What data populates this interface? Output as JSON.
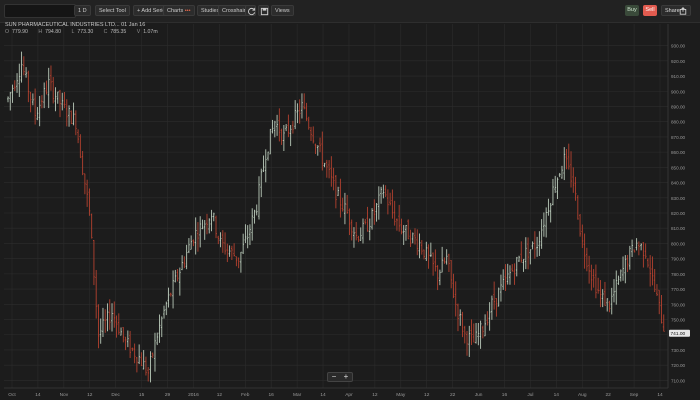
{
  "toolbar": {
    "symbol_value": "",
    "interval": "1 D",
    "select_tool": "Select Tool",
    "add_series": "+ Add Series",
    "charts_label": "Charts",
    "charts_accent": "•••",
    "studies": "Studies",
    "crosshair": "Crosshair",
    "views": "Views",
    "buy": "Buy",
    "sell": "Sell",
    "share": "Share"
  },
  "info": {
    "title": "SUN PHARMACEUTICAL INDUSTRIES LTD... 01 Jan 16",
    "ohlc": [
      {
        "k": "O",
        "v": "779.90"
      },
      {
        "k": "H",
        "v": "794.80"
      },
      {
        "k": "L",
        "v": "773.30"
      },
      {
        "k": "C",
        "v": "785.35"
      },
      {
        "k": "V",
        "v": "1.07m"
      }
    ]
  },
  "zoom": {
    "minus": "−",
    "plus": "+"
  },
  "colors": {
    "up": "#b9c9b9",
    "down": "#b3412f",
    "grid": "#2c2c2c",
    "background": "#1c1c1c",
    "last_price": "#e6e6e6"
  },
  "chart_data": {
    "type": "candlestick",
    "x_labels": [
      "Oct",
      "14",
      "Nov",
      "12",
      "Dec",
      "15",
      "29",
      "2016",
      "12",
      "Feb",
      "16",
      "Mar",
      "14",
      "Apr",
      "12",
      "May",
      "12",
      "22",
      "Jun",
      "16",
      "Jul",
      "14",
      "Aug",
      "22",
      "Sep",
      "14"
    ],
    "y_ticks": [
      "930.00",
      "920.00",
      "910.00",
      "900.00",
      "890.00",
      "880.00",
      "870.00",
      "860.00",
      "850.00",
      "840.00",
      "830.00",
      "820.00",
      "810.00",
      "800.00",
      "790.00",
      "780.00",
      "770.00",
      "760.00",
      "750.00",
      "740.00",
      "730.00",
      "720.00",
      "710.00"
    ],
    "last_price": "741.00",
    "ylim": [
      705,
      935
    ],
    "trend": [
      [
        0,
        895
      ],
      [
        6,
        918
      ],
      [
        12,
        885
      ],
      [
        18,
        905
      ],
      [
        24,
        890
      ],
      [
        30,
        880
      ],
      [
        36,
        820
      ],
      [
        40,
        740
      ],
      [
        46,
        755
      ],
      [
        52,
        735
      ],
      [
        58,
        725
      ],
      [
        62,
        715
      ],
      [
        66,
        740
      ],
      [
        70,
        760
      ],
      [
        74,
        775
      ],
      [
        78,
        790
      ],
      [
        82,
        805
      ],
      [
        86,
        812
      ],
      [
        90,
        820
      ],
      [
        94,
        800
      ],
      [
        98,
        795
      ],
      [
        102,
        790
      ],
      [
        106,
        805
      ],
      [
        110,
        825
      ],
      [
        114,
        860
      ],
      [
        118,
        880
      ],
      [
        122,
        870
      ],
      [
        126,
        880
      ],
      [
        130,
        890
      ],
      [
        134,
        875
      ],
      [
        138,
        860
      ],
      [
        142,
        845
      ],
      [
        146,
        830
      ],
      [
        150,
        820
      ],
      [
        154,
        805
      ],
      [
        158,
        810
      ],
      [
        162,
        820
      ],
      [
        166,
        835
      ],
      [
        170,
        820
      ],
      [
        174,
        810
      ],
      [
        178,
        805
      ],
      [
        182,
        800
      ],
      [
        186,
        790
      ],
      [
        190,
        780
      ],
      [
        194,
        790
      ],
      [
        198,
        760
      ],
      [
        202,
        740
      ],
      [
        206,
        735
      ],
      [
        210,
        745
      ],
      [
        214,
        760
      ],
      [
        218,
        770
      ],
      [
        222,
        780
      ],
      [
        226,
        790
      ],
      [
        230,
        795
      ],
      [
        234,
        800
      ],
      [
        238,
        820
      ],
      [
        242,
        840
      ],
      [
        246,
        855
      ],
      [
        250,
        840
      ],
      [
        254,
        800
      ],
      [
        258,
        780
      ],
      [
        262,
        765
      ],
      [
        266,
        760
      ],
      [
        270,
        775
      ],
      [
        274,
        790
      ],
      [
        278,
        800
      ],
      [
        282,
        795
      ],
      [
        286,
        770
      ],
      [
        290,
        745
      ]
    ]
  }
}
